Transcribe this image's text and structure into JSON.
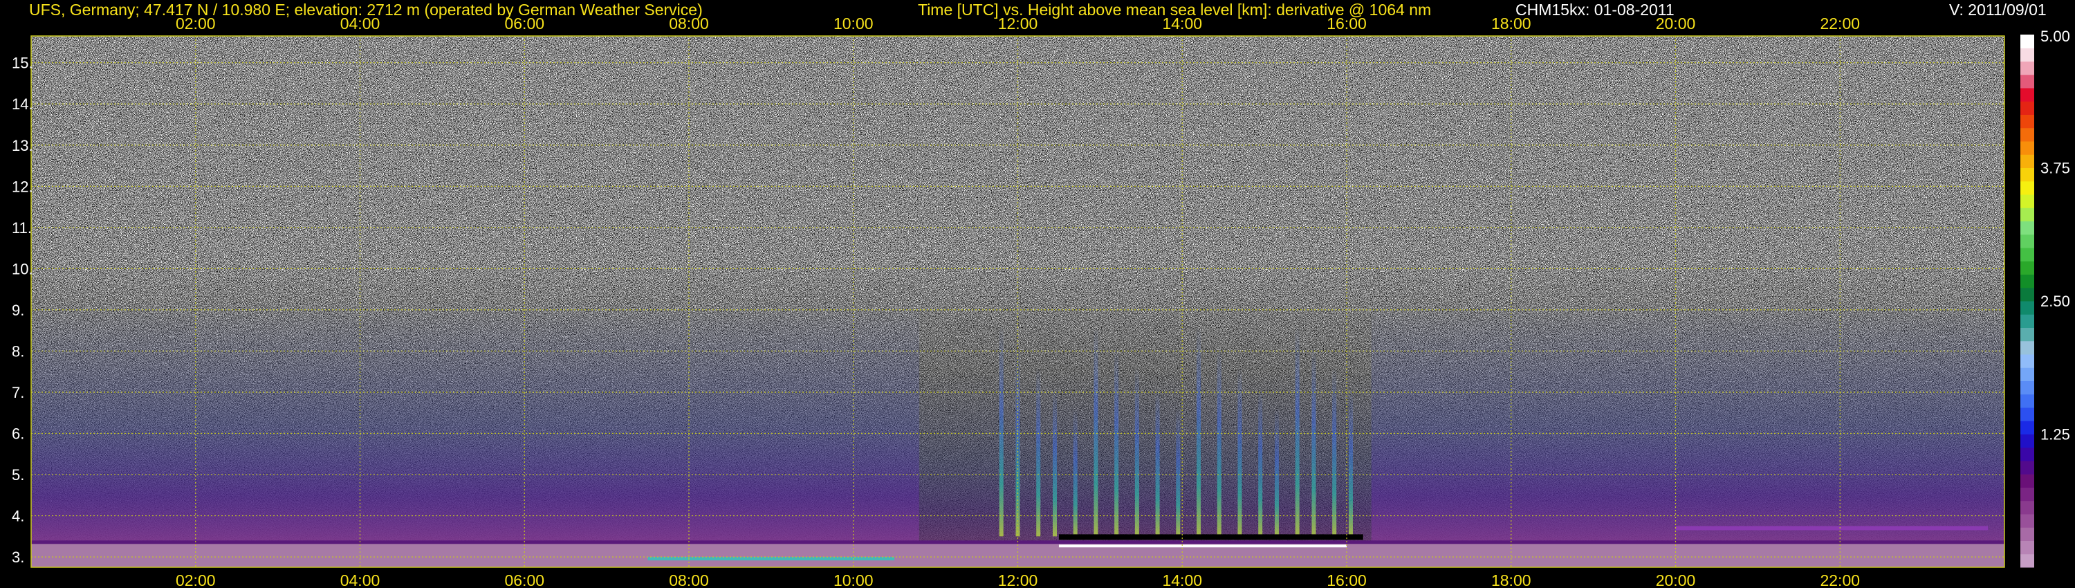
{
  "header": {
    "station": "UFS, Germany; 47.417 N / 10.980 E; elevation: 2712 m  (operated by German Weather Service)",
    "description": "Time [UTC] vs. Height above mean sea level [km]: derivative @ 1064 nm",
    "instrument": "CHM15kx: 01-08-2011",
    "version": "V: 2011/09/01"
  },
  "colors": {
    "label_color": "#f7e21b",
    "grid_color": "#c8c81e",
    "background": "#000000"
  },
  "chart_data": {
    "type": "heatmap",
    "title": "Time [UTC] vs. Height above mean sea level [km]: derivative @ 1064 nm",
    "xlabel": "Time [UTC]",
    "ylabel": "Height above mean sea level [km]",
    "x_tick_labels": [
      "02:00",
      "04:00",
      "06:00",
      "08:00",
      "10:00",
      "12:00",
      "14:00",
      "16:00",
      "18:00",
      "20:00",
      "22:00"
    ],
    "x_tick_values": [
      2,
      4,
      6,
      8,
      10,
      12,
      14,
      16,
      18,
      20,
      22
    ],
    "xlim": [
      0,
      24
    ],
    "y_tick_labels": [
      "3.",
      "4.",
      "5.",
      "6.",
      "7.",
      "8.",
      "9.",
      "10.",
      "11.",
      "12.",
      "13.",
      "14.",
      "15."
    ],
    "y_tick_values": [
      3,
      4,
      5,
      6,
      7,
      8,
      9,
      10,
      11,
      12,
      13,
      14,
      15
    ],
    "ylim": [
      2.75,
      15.65
    ],
    "grid": true,
    "colorbar": {
      "range": [
        0,
        5
      ],
      "tick_labels": [
        "1.25",
        "2.50",
        "3.75",
        "5.00"
      ],
      "tick_values": [
        1.25,
        2.5,
        3.75,
        5.0
      ],
      "colors": [
        "#c79ec6",
        "#b884b6",
        "#a86aa6",
        "#99509a",
        "#8a3a8e",
        "#7a2484",
        "#6a1078",
        "#520a8c",
        "#3a06a8",
        "#2010c8",
        "#1a2ae6",
        "#2c50f0",
        "#4070f4",
        "#5a8cf6",
        "#74a6f8",
        "#90bcfa",
        "#98c2dc",
        "#5aaeae",
        "#2a9c90",
        "#108a6c",
        "#0a7a3c",
        "#128e28",
        "#2aa82a",
        "#44c044",
        "#60d060",
        "#7ee07e",
        "#a6ec50",
        "#d4f428",
        "#f6f010",
        "#f8d20a",
        "#f8b00a",
        "#f88e0a",
        "#f46c0a",
        "#ee460a",
        "#e42414",
        "#e40c2c",
        "#e45a7a",
        "#f0a6b8",
        "#f8dce4",
        "#ffffff"
      ]
    }
  }
}
